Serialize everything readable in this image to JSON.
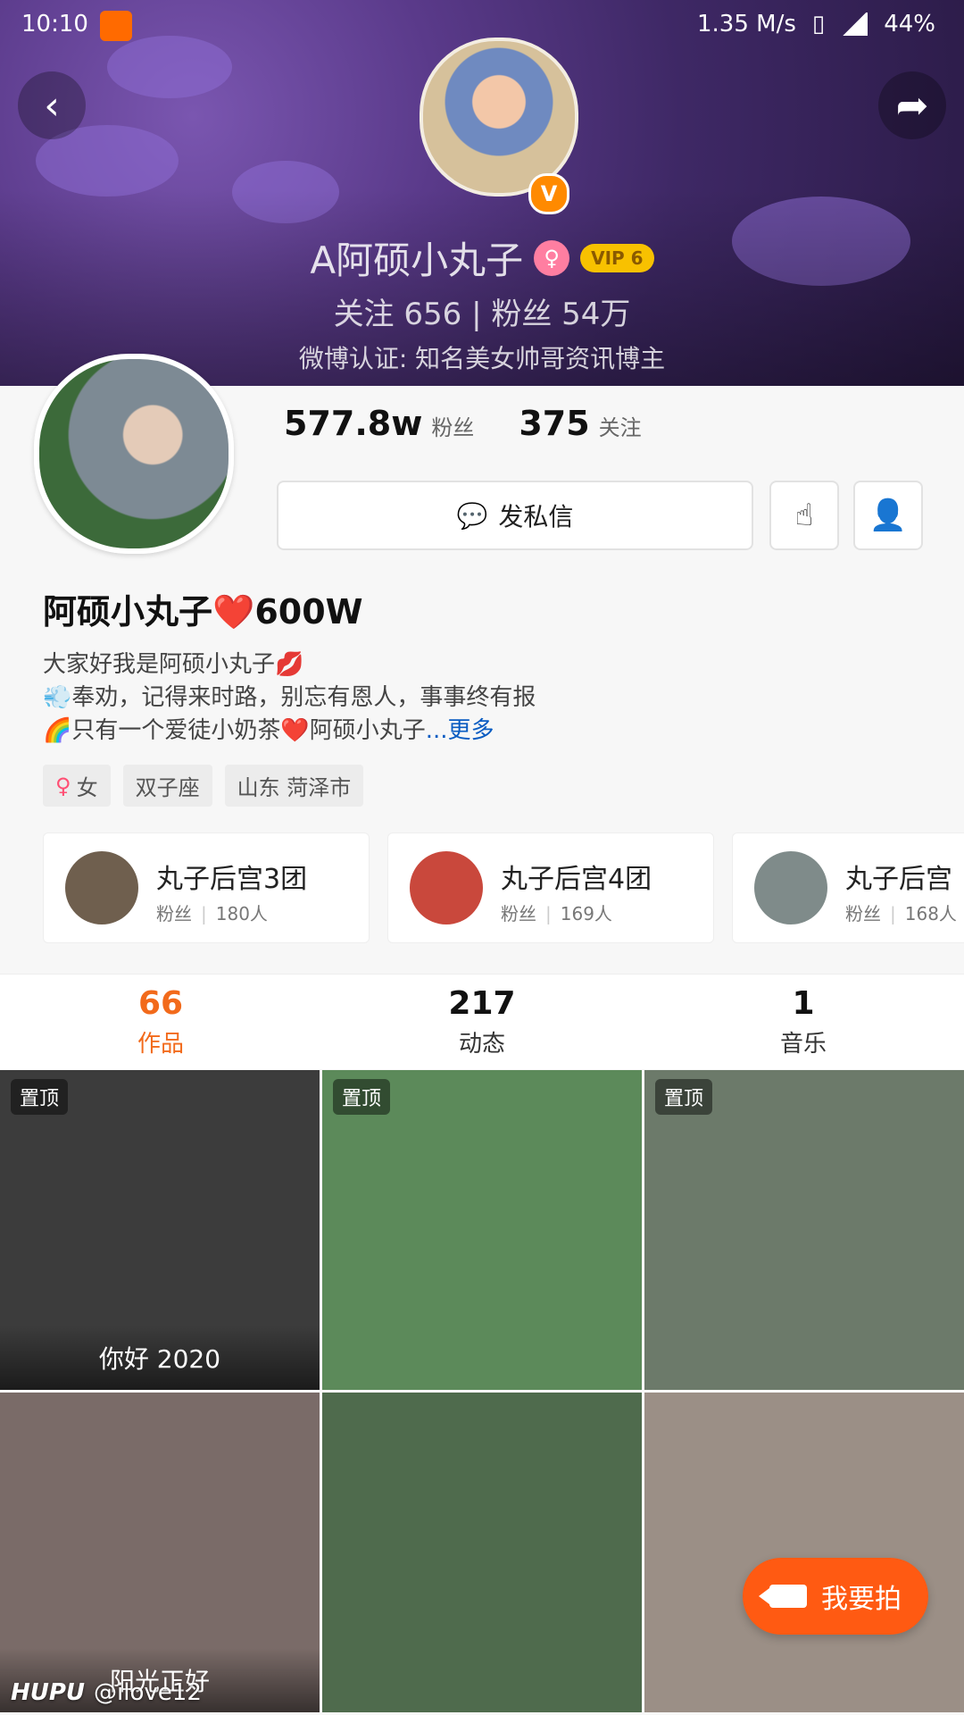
{
  "status": {
    "time": "10:10",
    "speed": "1.35 M/s",
    "battery": "44%"
  },
  "header": {
    "banner_name": "A阿硕小丸子",
    "vip": "VIP 6",
    "follow_text": "关注 656  |  粉丝 54万",
    "certification": "微博认证: 知名美女帅哥资讯博主"
  },
  "profile": {
    "fans_count": "577.8w",
    "fans_label": "粉丝",
    "following_count": "375",
    "following_label": "关注",
    "message_label": "发私信",
    "name": "阿硕小丸子❤️600W",
    "bio": [
      "大家好我是阿硕小丸子💋",
      "💨奉劝，记得来时路，别忘有恩人，事事终有报",
      "🌈只有一个爱徒小奶茶❤️阿硕小丸子"
    ],
    "bio_more": "...更多",
    "tags": [
      {
        "icon": "female-icon",
        "label": "女"
      },
      {
        "label": "双子座"
      },
      {
        "label": "山东 菏泽市"
      }
    ]
  },
  "groups": [
    {
      "title": "丸子后宫3团",
      "sub_label": "粉丝",
      "count": "180人"
    },
    {
      "title": "丸子后宫4团",
      "sub_label": "粉丝",
      "count": "169人"
    },
    {
      "title": "丸子后宫",
      "sub_label": "粉丝",
      "count": "168人"
    }
  ],
  "tabs": [
    {
      "num": "66",
      "label": "作品",
      "active": true
    },
    {
      "num": "217",
      "label": "动态"
    },
    {
      "num": "1",
      "label": "音乐"
    }
  ],
  "grid": [
    {
      "pin": "置顶",
      "caption": "你好 2020",
      "bg": "#3c3c3c"
    },
    {
      "pin": "置顶",
      "caption": "",
      "bg": "#5c8a5a"
    },
    {
      "pin": "置顶",
      "caption": "",
      "bg": "#6c7a6a"
    },
    {
      "pin": "",
      "caption": "阳光正好",
      "bg": "#7a6b68"
    },
    {
      "pin": "",
      "caption": "",
      "bg": "#4f6b4d"
    },
    {
      "pin": "",
      "caption": "",
      "bg": "#9b8f86"
    }
  ],
  "fab": {
    "label": "我要拍"
  },
  "watermark": {
    "brand": "HUPU",
    "handle": "@ilove12"
  },
  "colors": {
    "accent": "#f26a1b",
    "fab": "#ff5a12",
    "link": "#0a5cc2"
  }
}
